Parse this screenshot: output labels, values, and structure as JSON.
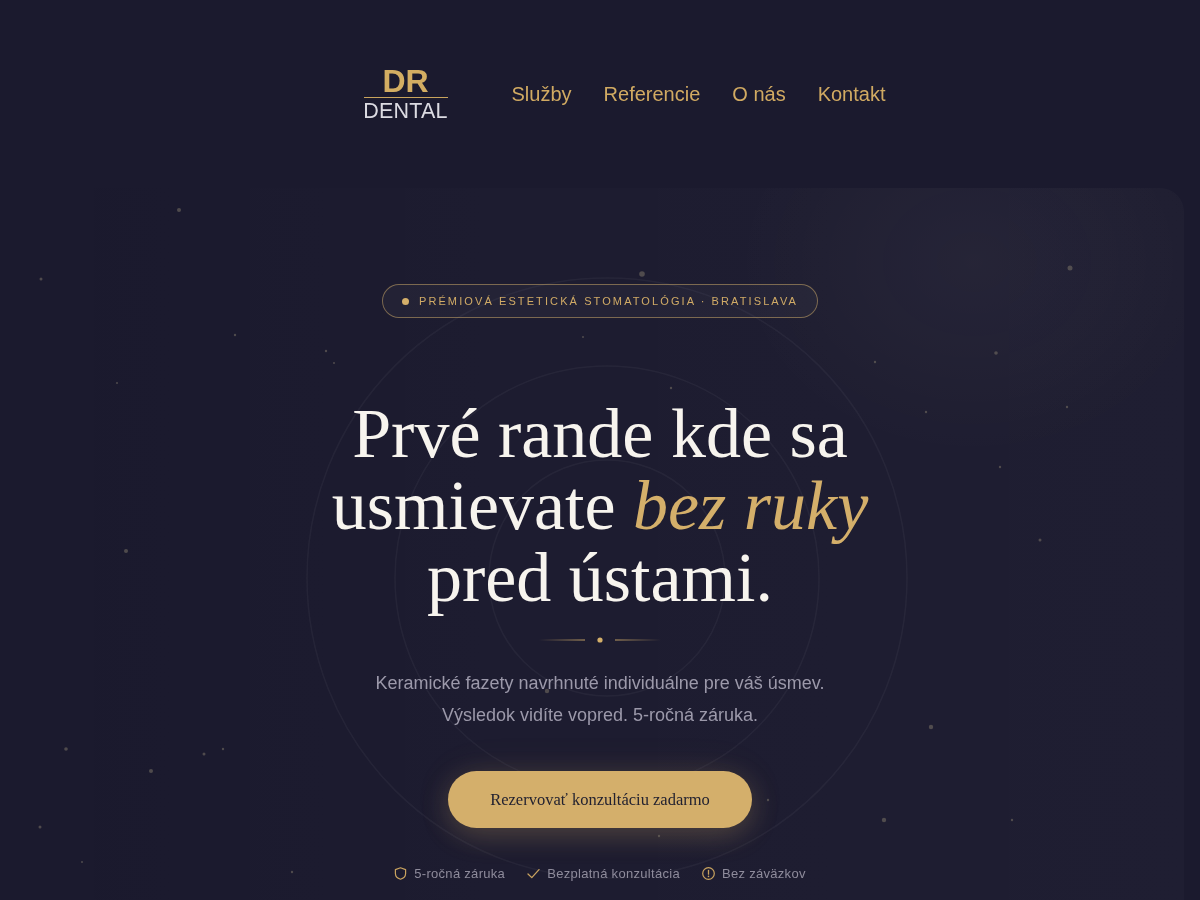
{
  "header": {
    "logo": {
      "monogram": "DR",
      "wordmark": "DENTAL"
    },
    "nav": [
      "Služby",
      "Referencie",
      "O nás",
      "Kontakt"
    ]
  },
  "hero": {
    "badge": "PRÉMIOVÁ ESTETICKÁ STOMATOLÓGIA · BRATISLAVA",
    "heading": "Prvé rande kde sa\nusmievate *bez ruky*\npred ústami.",
    "subtitle": "Keramické fazety navrhnuté individuálne pre váš úsmev.\nVýsledok vidíte vopred. 5-ročná záruka.",
    "cta": "Rezervovať konzultáciu zadarmo",
    "trust": [
      {
        "kind": "shield",
        "label": "5-ročná záruka"
      },
      {
        "kind": "check",
        "label": "Bezplatná konzultácia"
      },
      {
        "kind": "alert",
        "label": "Bez záväzkov"
      }
    ]
  }
}
